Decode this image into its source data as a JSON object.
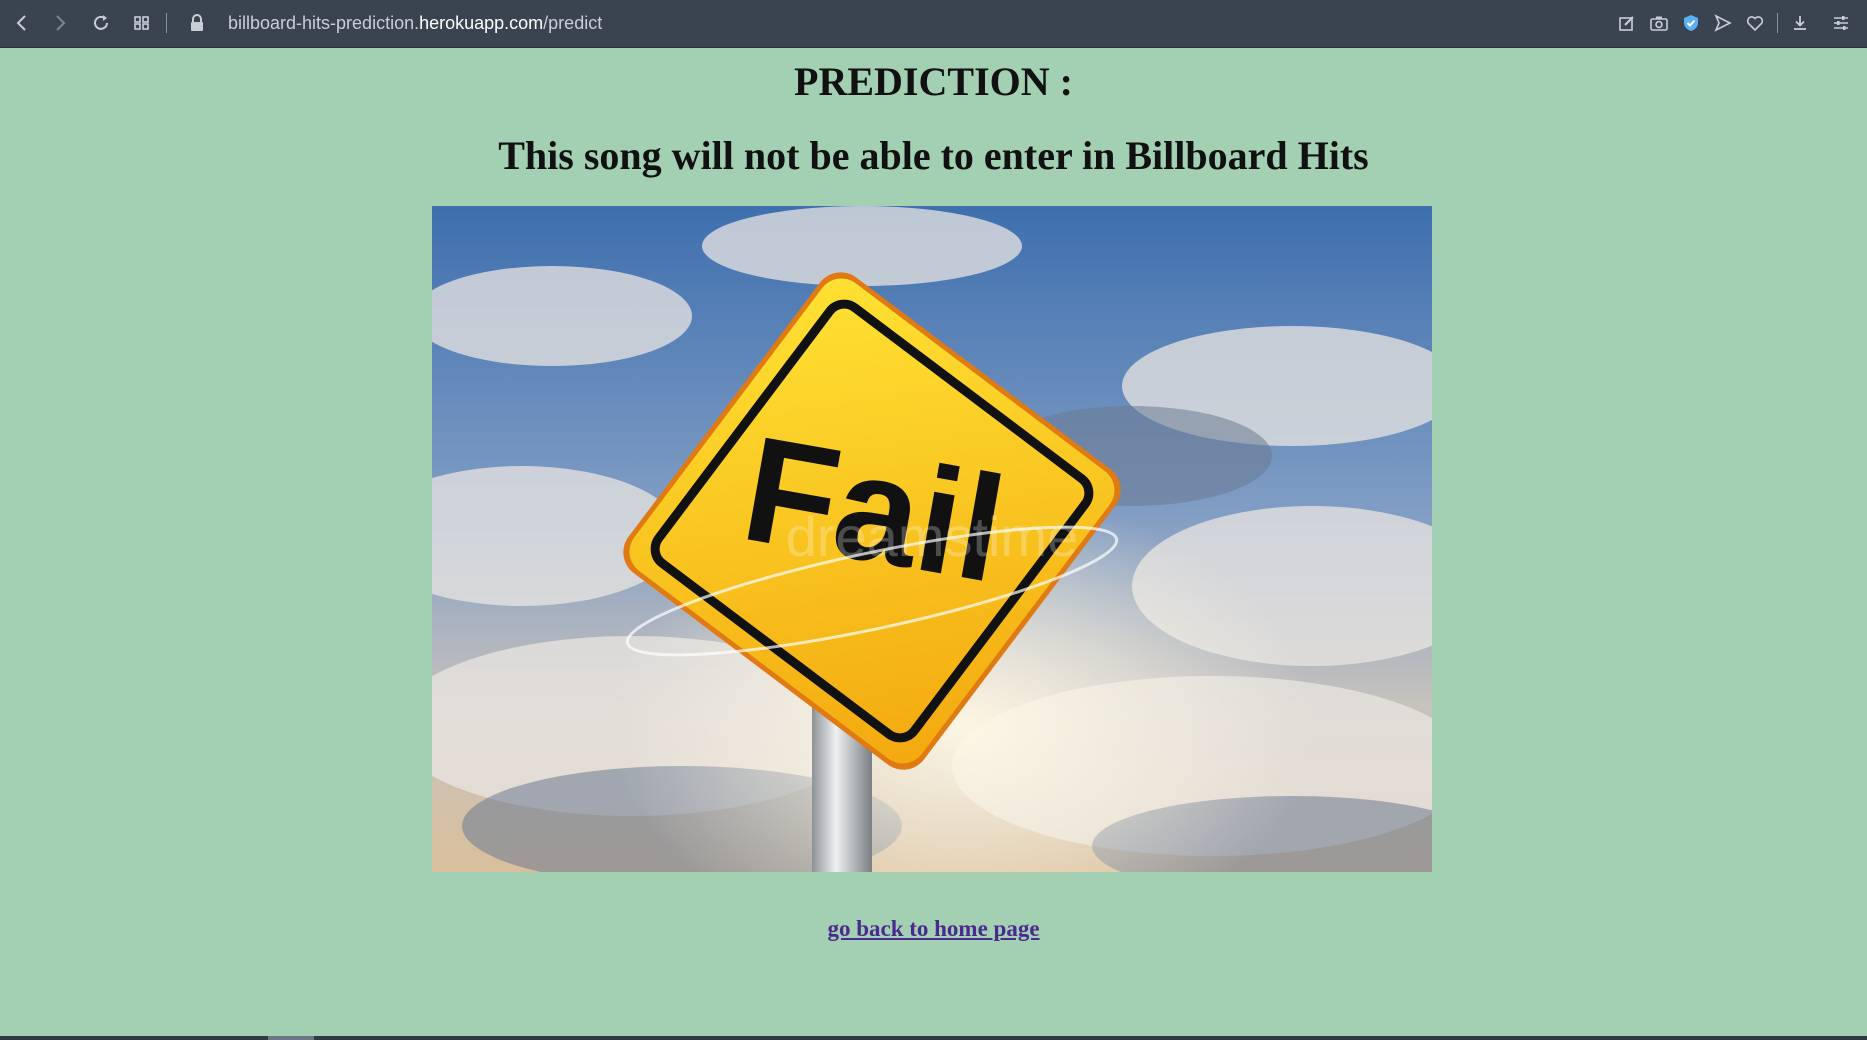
{
  "browser": {
    "url_prefix": "billboard-hits-prediction.",
    "url_host": "herokuapp.com",
    "url_path": "/predict"
  },
  "page": {
    "heading": "PREDICTION :",
    "message": "This song will not be able to enter in Billboard Hits",
    "image": {
      "sign_text": "Fail",
      "watermark": "dreamstime"
    },
    "home_link": "go back to home page"
  },
  "colors": {
    "page_background": "#a3d0b3",
    "toolbar": "#3a4350",
    "link": "#4b2a8f",
    "sign_yellow": "#f7c517"
  }
}
